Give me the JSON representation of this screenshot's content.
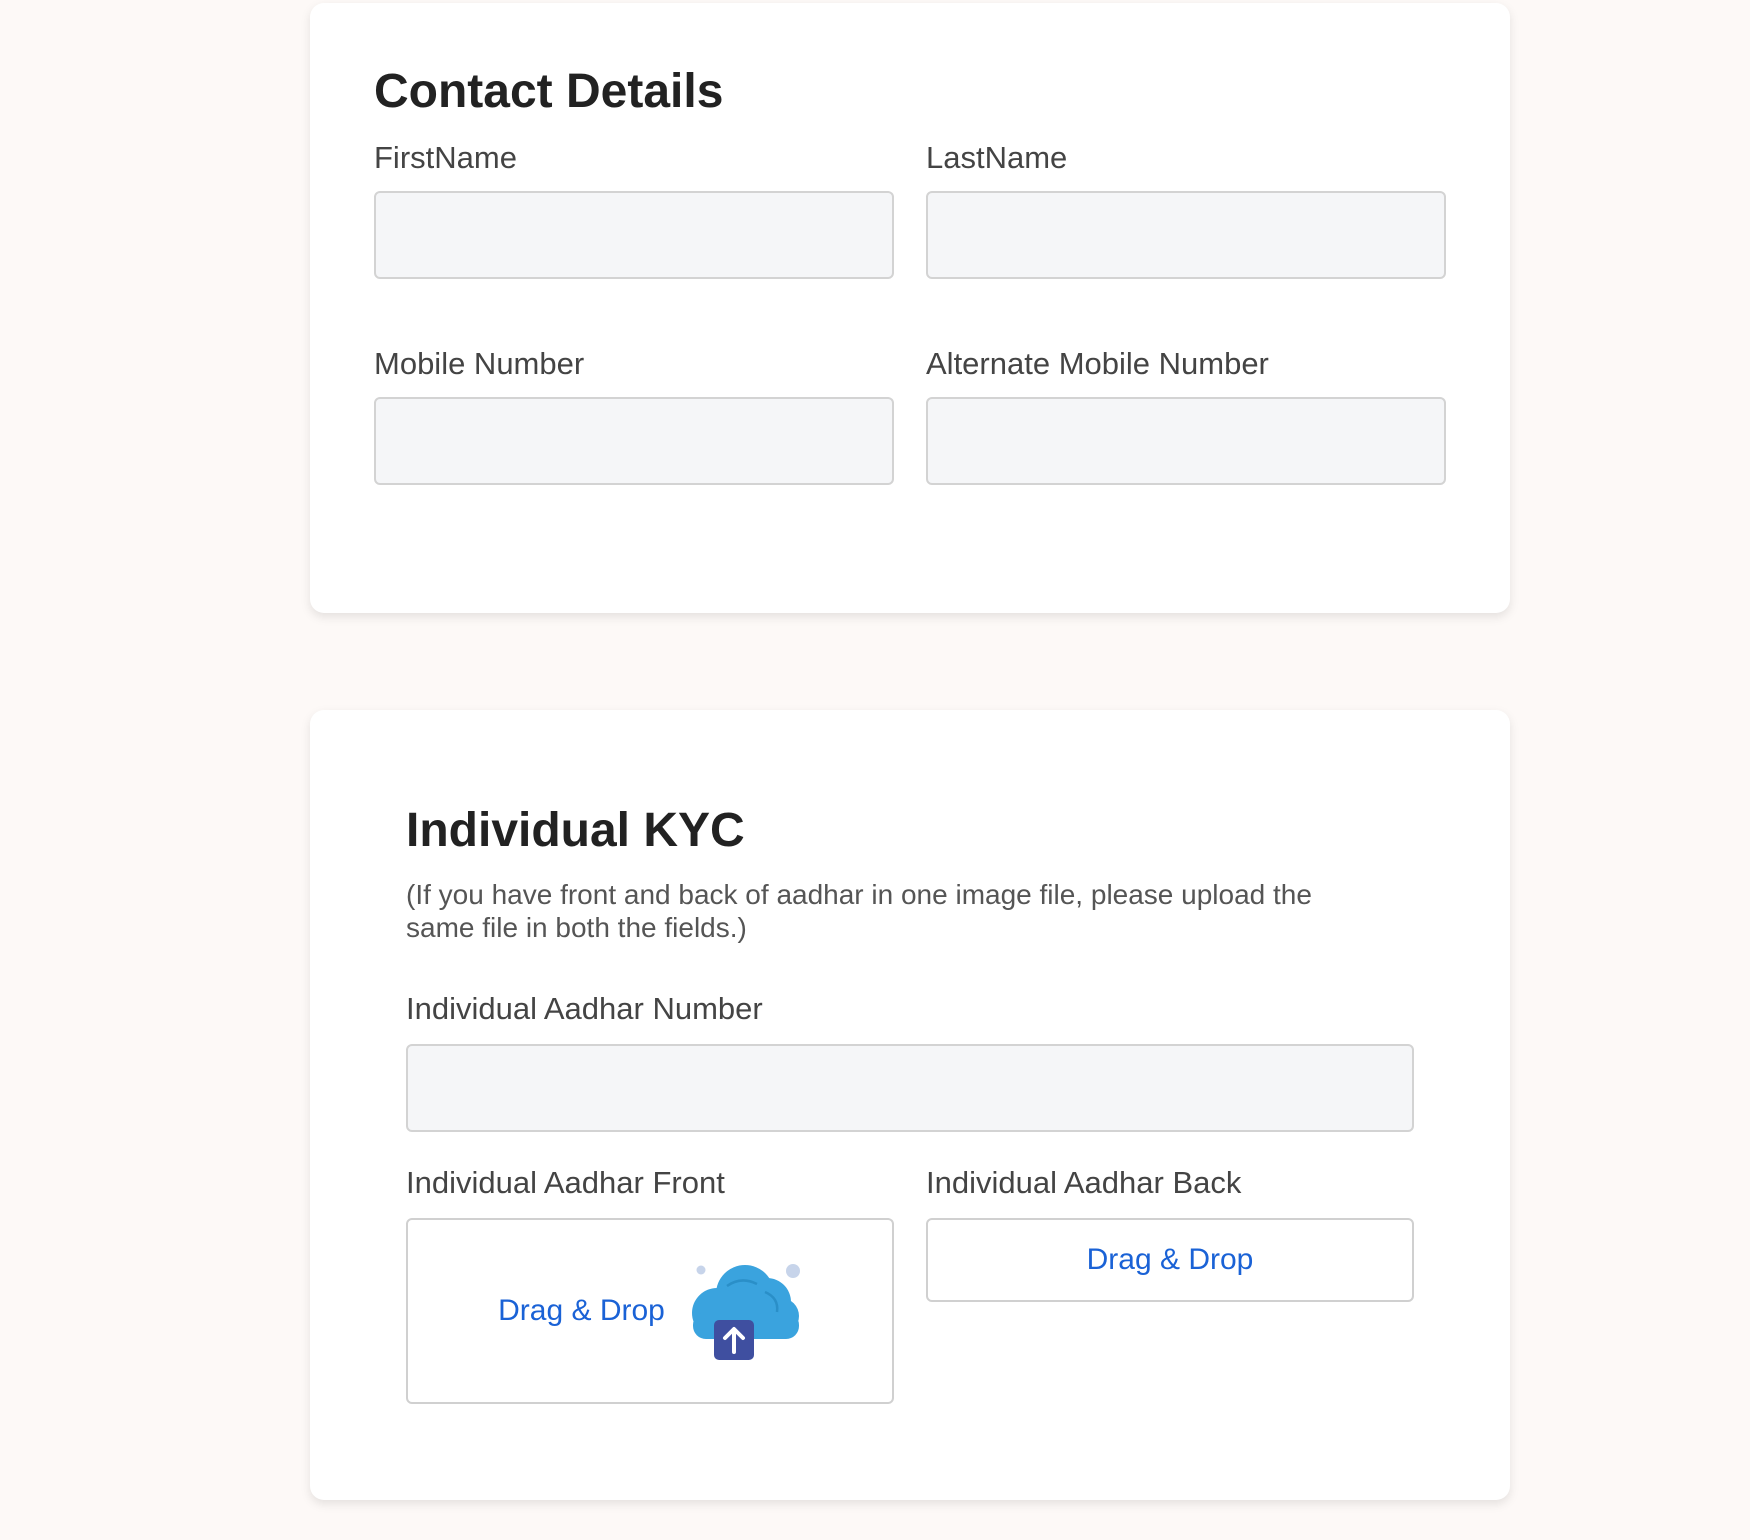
{
  "contact": {
    "title": "Contact Details",
    "first_name_label": "FirstName",
    "first_name_value": "",
    "last_name_label": "LastName",
    "last_name_value": "",
    "mobile_label": "Mobile Number",
    "mobile_value": "",
    "alt_mobile_label": "Alternate Mobile Number",
    "alt_mobile_value": ""
  },
  "kyc": {
    "title": "Individual KYC",
    "note": "(If you have front and back of aadhar in one image file, please upload the same file in both the fields.)",
    "aadhar_number_label": "Individual Aadhar Number",
    "aadhar_number_value": "",
    "front_label": "Individual Aadhar Front",
    "front_drop_text": "Drag & Drop",
    "back_label": "Individual Aadhar Back",
    "back_drop_text": "Drag & Drop"
  },
  "colors": {
    "page_background": "#fdf9f7",
    "link_blue": "#1a62d6",
    "input_background": "#f5f6f8",
    "cloud_blue": "#3aa3de",
    "arrow_box": "#3f4fa0"
  },
  "icons": {
    "upload": "cloud-upload-icon"
  }
}
